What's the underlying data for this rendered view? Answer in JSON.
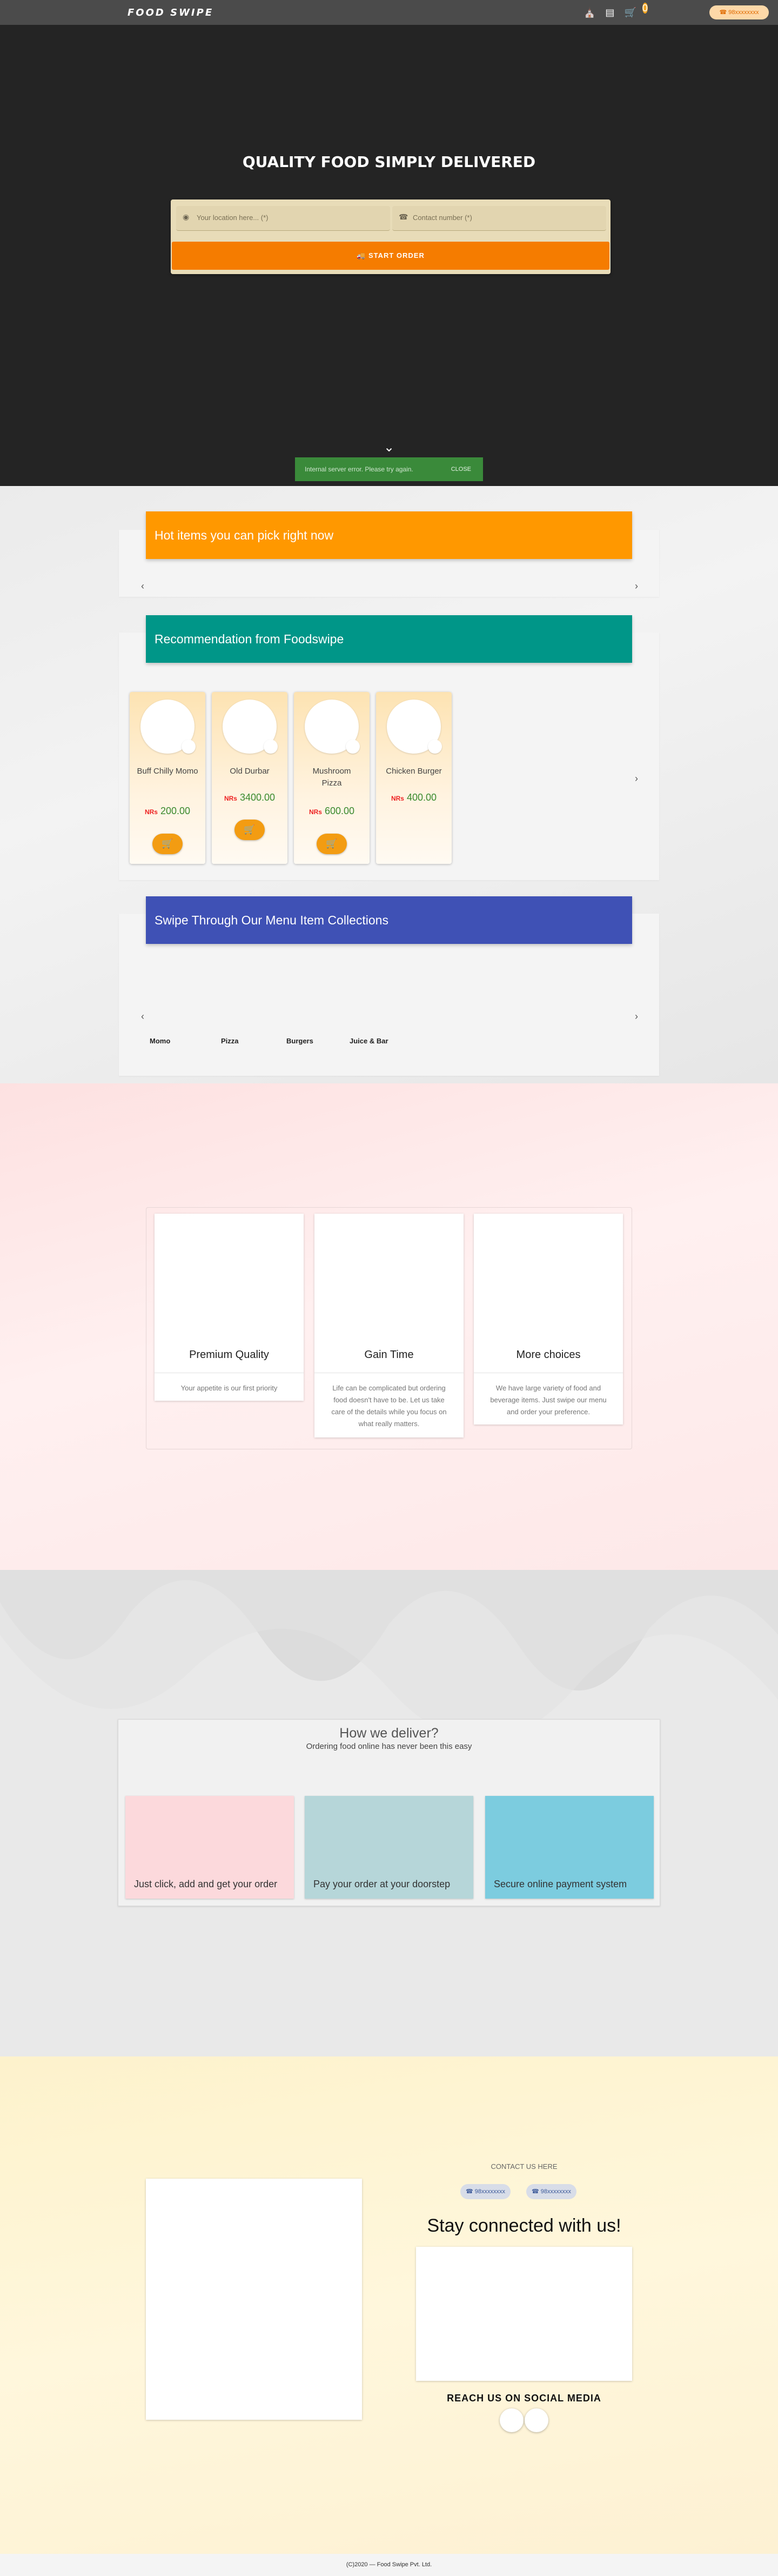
{
  "header": {
    "logo": "FOOD SWIPE",
    "icons": [
      "store-icon",
      "receipt-icon",
      "cart-icon"
    ],
    "cart_count": "0",
    "phone": "98xxxxxxxx"
  },
  "hero": {
    "title": "QUALITY FOOD SIMPLY DELIVERED",
    "location_placeholder": "Your location here... (*)",
    "contact_placeholder": "Contact number (*)",
    "start_order": "START ORDER",
    "snackbar_message": "Internal server error. Please try again.",
    "snackbar_close": "CLOSE"
  },
  "sections": {
    "hot": {
      "title": "Hot items you can pick right now",
      "color": "#ff9800"
    },
    "recommend": {
      "title": "Recommendation from Foodswipe",
      "color": "#009688"
    },
    "collections": {
      "title": "Swipe Through Our Menu Item Collections",
      "color": "#3f51b5"
    }
  },
  "recommendations": [
    {
      "name": "Buff Chilly Momo",
      "currency": "NRs",
      "price": "200.00"
    },
    {
      "name": "Old Durbar",
      "currency": "NRs",
      "price": "3400.00"
    },
    {
      "name": "Mushroom Pizza",
      "currency": "NRs",
      "price": "600.00"
    },
    {
      "name": "Chicken Burger",
      "currency": "NRs",
      "price": "400.00"
    }
  ],
  "collections": [
    "Momo",
    "Pizza",
    "Burgers",
    "Juice & Bar"
  ],
  "features": [
    {
      "title": "Premium Quality",
      "desc": "Your appetite is our first priority"
    },
    {
      "title": "Gain Time",
      "desc": "Life can be complicated but ordering food doesn't have to be. Let us take care of the details while you focus on what really matters."
    },
    {
      "title": "More choices",
      "desc": "We have large variety of food and beverage items. Just swipe our menu and order your preference."
    }
  ],
  "deliver": {
    "title": "How we deliver?",
    "subtitle": "Ordering food online has never been this easy",
    "steps": [
      {
        "label": "Just click, add and get your order",
        "color": "#fcd9dc"
      },
      {
        "label": "Pay your order at your doorstep",
        "color": "#b6d6d9"
      },
      {
        "label": "Secure online payment system",
        "color": "#7cccdf"
      }
    ]
  },
  "contact": {
    "label": "CONTACT US HERE",
    "phone1": "98xxxxxxxx",
    "phone2": "98xxxxxxxx",
    "stay": "Stay connected with us!",
    "reach": "REACH US ON SOCIAL MEDIA"
  },
  "footer": "(C)2020 — Food Swipe Pvt. Ltd."
}
